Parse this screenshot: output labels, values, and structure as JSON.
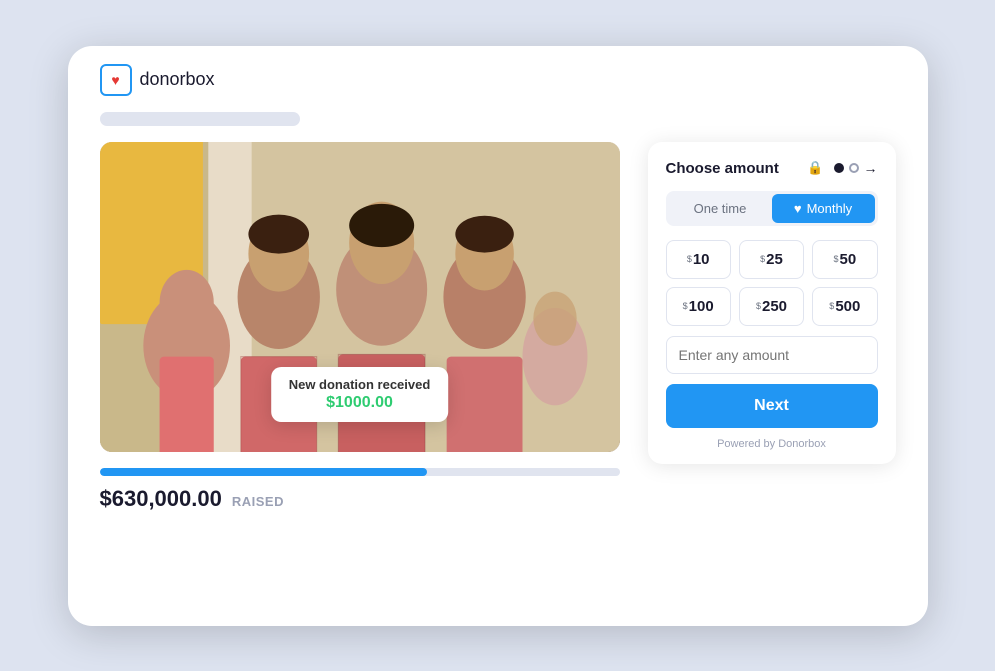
{
  "logo": {
    "icon_symbol": "♥",
    "text": "donorbox"
  },
  "header": {
    "placeholder_bar": true
  },
  "campaign": {
    "raised_amount": "$630,000.00",
    "raised_label": "RAISED",
    "progress_percent": 63,
    "notification": {
      "title": "New donation received",
      "amount": "$1000.00"
    }
  },
  "widget": {
    "title": "Choose amount",
    "lock_icon": "🔒",
    "steps": [
      "active",
      "inactive"
    ],
    "frequency": {
      "options": [
        {
          "label": "One time",
          "active": false
        },
        {
          "label": "Monthly",
          "active": true,
          "icon": "♥"
        }
      ]
    },
    "amounts": [
      {
        "currency": "$",
        "value": "10"
      },
      {
        "currency": "$",
        "value": "25"
      },
      {
        "currency": "$",
        "value": "50"
      },
      {
        "currency": "$",
        "value": "100"
      },
      {
        "currency": "$",
        "value": "250"
      },
      {
        "currency": "$",
        "value": "500"
      }
    ],
    "custom_input_placeholder": "Enter any amount",
    "next_button_label": "Next",
    "powered_by": "Powered by Donorbox"
  }
}
